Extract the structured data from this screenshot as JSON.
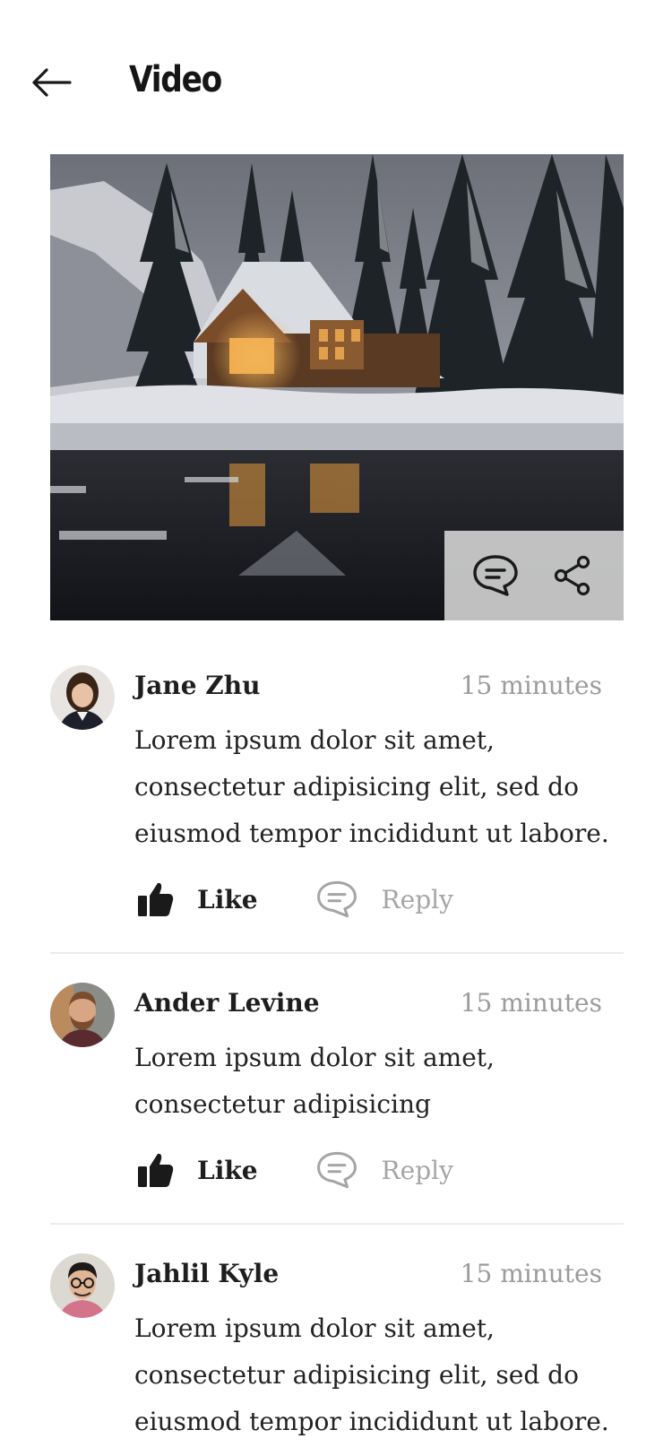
{
  "header": {
    "title": "Video",
    "back_icon": "arrow-left-icon"
  },
  "video": {
    "actions": [
      {
        "icon": "comment-icon"
      },
      {
        "icon": "share-icon"
      }
    ]
  },
  "comments": [
    {
      "name": "Jane Zhu",
      "time": "15 minutes",
      "text": "Lorem ipsum dolor sit amet, consectetur adipisicing elit, sed do eiusmod tempor incididunt ut labore.",
      "like_label": "Like",
      "reply_label": "Reply"
    },
    {
      "name": "Ander Levine",
      "time": "15 minutes",
      "text": "Lorem ipsum dolor sit amet, consectetur adipisicing",
      "like_label": "Like",
      "reply_label": "Reply"
    },
    {
      "name": "Jahlil Kyle",
      "time": "15 minutes",
      "text": "Lorem ipsum dolor sit amet, consectetur adipisicing elit, sed do eiusmod tempor incididunt ut labore.",
      "like_label": "Like",
      "reply_label": "Reply"
    }
  ],
  "colors": {
    "text": "#1c1c1c",
    "muted": "#9b9b9b",
    "divider": "#ececec",
    "overlay": "#cdcdcd"
  }
}
